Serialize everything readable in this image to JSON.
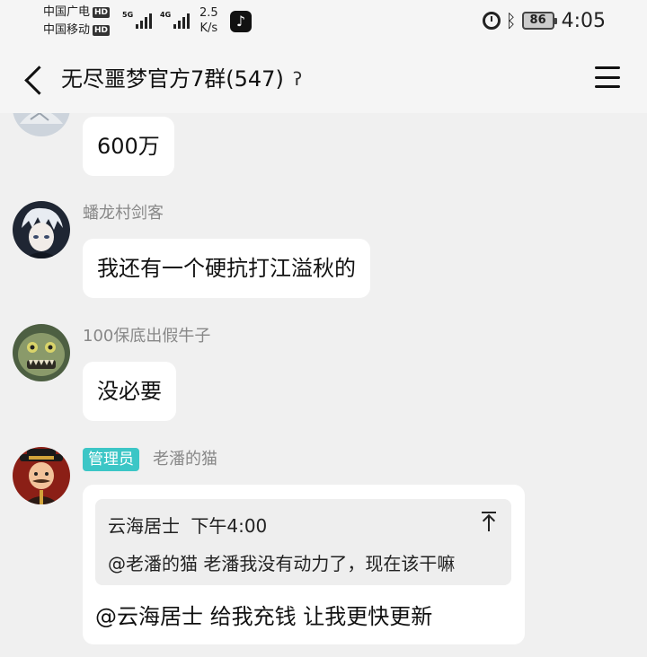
{
  "status_bar": {
    "carrier1": "中国广电",
    "carrier2": "中国移动",
    "hd_label": "HD",
    "net1": "5G",
    "net2": "4G",
    "speed_value": "2.5",
    "speed_unit": "K/s",
    "battery": "86",
    "time": "4:05"
  },
  "header": {
    "title": "无尽噩梦官方7群(547)"
  },
  "messages": [
    {
      "sender": "",
      "text": "600万"
    },
    {
      "sender": "蟠龙村剑客",
      "text": "我还有一个硬抗打江溢秋的"
    },
    {
      "sender": "100保底出假牛子",
      "text": "没必要"
    },
    {
      "badge": "管理员",
      "sender": "老潘的猫",
      "quote": {
        "author": "云海居士",
        "time": "下午4:00",
        "text": "@老潘的猫 老潘我没有动力了，现在该干嘛"
      },
      "text": "@云海居士 给我充钱 让我更快更新"
    }
  ],
  "colors": {
    "admin_badge": "#3cc6c6",
    "chat_bg": "#f0f0f0",
    "bubble_bg": "#ffffff"
  }
}
